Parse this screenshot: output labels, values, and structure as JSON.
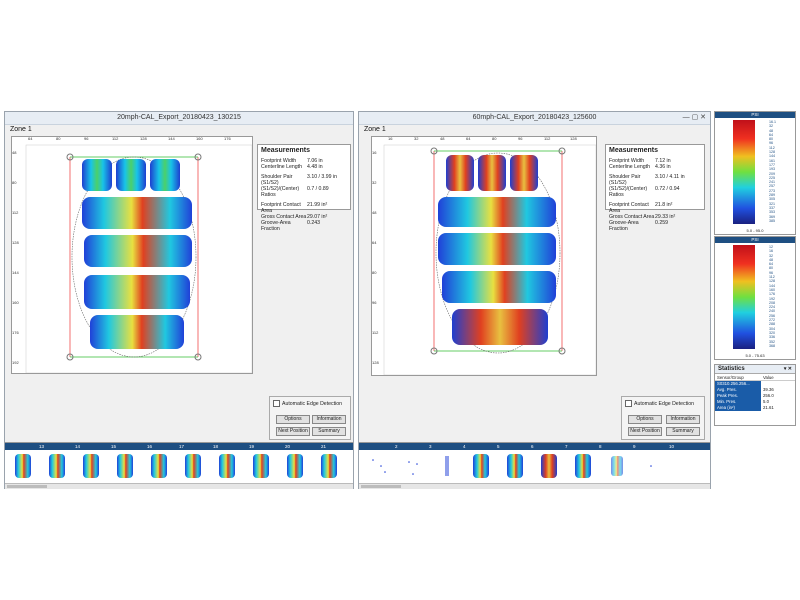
{
  "left": {
    "title": "20mph-CAL_Export_20180423_130215",
    "zone": "Zone 1",
    "x_ticks": [
      "64",
      "80",
      "96",
      "112",
      "128",
      "144",
      "160",
      "176"
    ],
    "y_ticks": [
      "48",
      "80",
      "112",
      "128",
      "144",
      "160",
      "176",
      "192"
    ],
    "measurements": {
      "header": "Measurements",
      "rows": [
        {
          "k": "Footprint Width",
          "v": "7.06 in"
        },
        {
          "k": "Centerline Length",
          "v": "4.48 in"
        },
        {
          "k": "Shoulder Pair (S1/S2)",
          "v": "3.10 / 3.99 in"
        },
        {
          "k": "(S1/S2)/(Center) Ratios",
          "v": "0.7 / 0.89"
        },
        {
          "k": "Footprint Contact Area",
          "v": "21.99 in²"
        },
        {
          "k": "Gross Contact Area",
          "v": "29.07 in²"
        },
        {
          "k": "Groove-Area Fraction",
          "v": "0.243"
        }
      ]
    },
    "auto_edge": "Automatic Edge Detection",
    "btn_options": "Options",
    "btn_information": "Information",
    "btn_next": "Next Position",
    "btn_summary": "Summary",
    "frames": [
      "13",
      "14",
      "15",
      "16",
      "17",
      "18",
      "19",
      "20",
      "21"
    ]
  },
  "right": {
    "title": "60mph-CAL_Export_20180423_125600",
    "zone": "Zone 1",
    "x_ticks": [
      "16",
      "32",
      "48",
      "64",
      "80",
      "96",
      "112",
      "128"
    ],
    "y_ticks": [
      "16",
      "32",
      "48",
      "64",
      "80",
      "96",
      "112",
      "128"
    ],
    "measurements": {
      "header": "Measurements",
      "rows": [
        {
          "k": "Footprint Width",
          "v": "7.12 in"
        },
        {
          "k": "Centerline Length",
          "v": "4.36 in"
        },
        {
          "k": "Shoulder Pair (S1/S2)",
          "v": "3.10 / 4.11 in"
        },
        {
          "k": "(S1/S2)/(Center) Ratios",
          "v": "0.72 / 0.94"
        },
        {
          "k": "Footprint Contact Area",
          "v": "21.8 in²"
        },
        {
          "k": "Gross Contact Area",
          "v": "29.33 in²"
        },
        {
          "k": "Groove-Area Fraction",
          "v": "0.259"
        }
      ]
    },
    "auto_edge": "Automatic Edge Detection",
    "btn_options": "Options",
    "btn_information": "Information",
    "btn_next": "Next Position",
    "btn_summary": "Summary",
    "frames": [
      "2",
      "3",
      "4",
      "5",
      "6",
      "7",
      "8",
      "9",
      "10"
    ]
  },
  "legend_top": {
    "title": "PSI",
    "values": [
      "16.1",
      "32",
      "48",
      "64",
      "80",
      "96",
      "112",
      "128",
      "144",
      "161",
      "177",
      "193",
      "209",
      "225",
      "241",
      "257",
      "273",
      "289",
      "305",
      "321",
      "337",
      "353",
      "369",
      "385"
    ],
    "footer": "5.0 - 95.0"
  },
  "legend_bottom": {
    "title": "PSI",
    "values": [
      "12",
      "16",
      "32",
      "48",
      "64",
      "80",
      "96",
      "112",
      "128",
      "144",
      "160",
      "176",
      "192",
      "208",
      "224",
      "240",
      "256",
      "272",
      "288",
      "304",
      "320",
      "336",
      "352",
      "368"
    ],
    "footer": "5.0 - 75.63"
  },
  "statistics": {
    "title": "Statistics",
    "col1": "Sensor/Group",
    "col2": "Value",
    "rows": [
      {
        "k": "S0310.256.256...",
        "v": ""
      },
      {
        "k": "Avg. Pres.",
        "v": "39.36"
      },
      {
        "k": "Peak Pres.",
        "v": "256.0"
      },
      {
        "k": "Min. Pres.",
        "v": "5.0"
      },
      {
        "k": "Area (in²)",
        "v": "21.61"
      }
    ]
  },
  "colors": {
    "header_blue": "#1e4f82",
    "stat_blue": "#1a5ca8"
  }
}
